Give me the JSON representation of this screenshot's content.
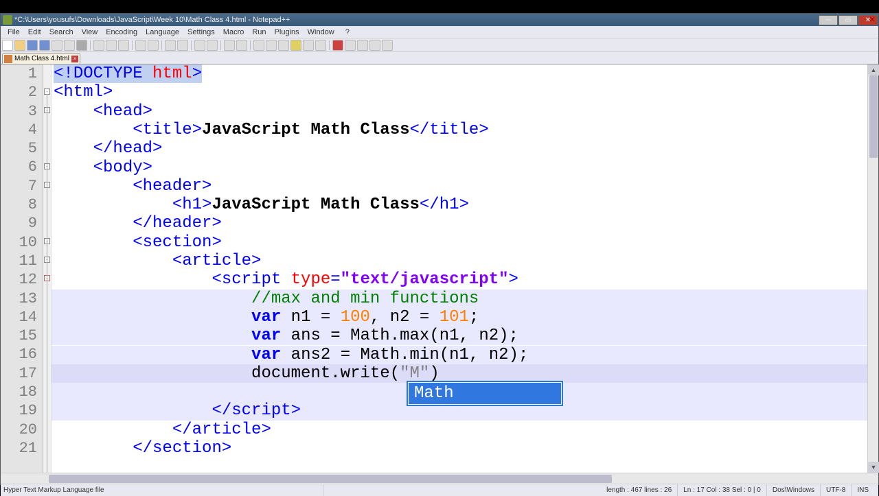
{
  "titlebar": {
    "text": "*C:\\Users\\yousufs\\Downloads\\JavaScript\\Week 10\\Math Class 4.html - Notepad++"
  },
  "menu": [
    "File",
    "Edit",
    "Search",
    "View",
    "Encoding",
    "Language",
    "Settings",
    "Macro",
    "Run",
    "Plugins",
    "Window",
    "?"
  ],
  "tab": {
    "label": "Math Class 4.html"
  },
  "lines": {
    "count": 21,
    "current": 17
  },
  "code": {
    "l1_a": "<!",
    "l1_b": "DOCTYPE",
    "l1_c": " html",
    "l1_d": ">",
    "l2_a": "<html>",
    "l3_a": "<head>",
    "l4_a": "<title>",
    "l4_b": "JavaScript Math Class",
    "l4_c": "</title>",
    "l5_a": "</head>",
    "l6_a": "<body>",
    "l7_a": "<header>",
    "l8_a": "<h1>",
    "l8_b": "JavaScript Math Class",
    "l8_c": "</h1>",
    "l9_a": "</header>",
    "l10_a": "<section>",
    "l11_a": "<article>",
    "l12_a": "<script ",
    "l12_b": "type",
    "l12_c": "=",
    "l12_d": "\"text/javascript\"",
    "l12_e": ">",
    "l13_a": "//max and min functions",
    "l14_a": "var",
    "l14_b": " n1 ",
    "l14_c": "=",
    "l14_d": " ",
    "l14_e": "100",
    "l14_f": ",",
    "l14_g": " n2 ",
    "l14_h": "=",
    "l14_hi": " ",
    "l14_i": "101",
    "l14_j": ";",
    "l15_a": "var",
    "l15_b": " ans ",
    "l15_c": "=",
    "l15_d": " Math",
    "l15_e": ".",
    "l15_f": "max",
    "l15_g": "(",
    "l15_h": "n1",
    "l15_i": ",",
    "l15_j": " n2",
    "l15_k": ")",
    "l15_l": ";",
    "l16_a": "var",
    "l16_b": " ans2 ",
    "l16_c": "=",
    "l16_d": " Math",
    "l16_e": ".",
    "l16_f": "min",
    "l16_g": "(",
    "l16_h": "n1",
    "l16_i": ",",
    "l16_j": " n2",
    "l16_k": ")",
    "l16_l": ";",
    "l17_a": "document",
    "l17_b": ".",
    "l17_c": "write",
    "l17_d": "(",
    "l17_e": "\"M\"",
    "l17_f": ")",
    "l19_a": "</script>",
    "l20_a": "</article>",
    "l21_a": "</section>"
  },
  "autocomplete": {
    "item": "Math"
  },
  "status": {
    "filetype": "Hyper Text Markup Language file",
    "length": "length : 467    lines : 26",
    "pos": "Ln : 17    Col : 38    Sel : 0 | 0",
    "eol": "Dos\\Windows",
    "enc": "UTF-8",
    "mode": "INS"
  }
}
